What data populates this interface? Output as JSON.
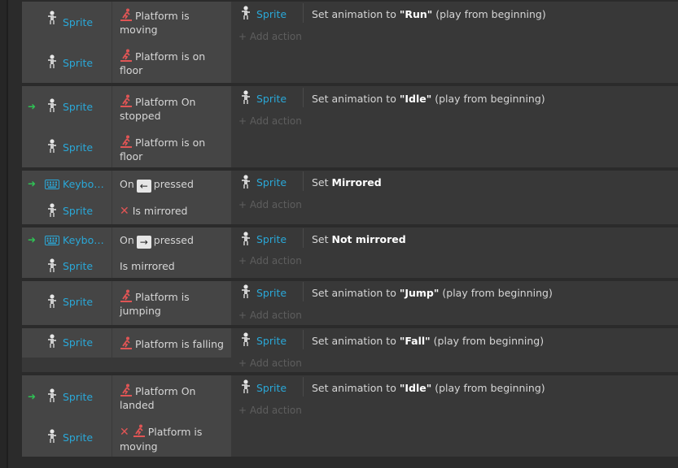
{
  "colors": {
    "object_link": "#2aa8d8",
    "trigger_arrow": "#2fc255",
    "invert_x": "#e05555",
    "add_action": "#5e5e5e"
  },
  "icons": {
    "sprite": "sprite-character-icon",
    "keyboard": "keyboard-icon",
    "platform": "platformer-behavior-icon",
    "invert": "invert-x-icon",
    "trigger": "trigger-arrow-icon",
    "add": "plus-icon"
  },
  "add_action_label": "Add action",
  "events": [
    {
      "conditions": [
        {
          "object": "Sprite",
          "text": "Platform is moving"
        },
        {
          "object": "Sprite",
          "text": "Platform is on floor"
        }
      ],
      "action": {
        "object": "Sprite",
        "prefix": "Set animation to ",
        "value": "\"Run\"",
        "suffix": " (play from beginning)"
      }
    },
    {
      "conditions": [
        {
          "object": "Sprite",
          "text": "Platform On stopped"
        },
        {
          "object": "Sprite",
          "text": "Platform is on floor"
        }
      ],
      "action": {
        "object": "Sprite",
        "prefix": "Set animation to ",
        "value": "\"Idle\"",
        "suffix": " (play from beginning)"
      }
    },
    {
      "conditions": [
        {
          "object": "Keybo…",
          "before": "On",
          "key": "←",
          "after": "pressed"
        },
        {
          "object": "Sprite",
          "text": "Is mirrored"
        }
      ],
      "action": {
        "object": "Sprite",
        "prefix": "Set ",
        "value": "Mirrored",
        "suffix": ""
      }
    },
    {
      "conditions": [
        {
          "object": "Keybo…",
          "before": "On",
          "key": "→",
          "after": "pressed"
        },
        {
          "object": "Sprite",
          "text": "Is mirrored"
        }
      ],
      "action": {
        "object": "Sprite",
        "prefix": "Set ",
        "value": "Not mirrored",
        "suffix": ""
      }
    },
    {
      "conditions": [
        {
          "object": "Sprite",
          "text": "Platform is jumping"
        }
      ],
      "action": {
        "object": "Sprite",
        "prefix": "Set animation to ",
        "value": "\"Jump\"",
        "suffix": " (play from beginning)"
      }
    },
    {
      "conditions": [
        {
          "object": "Sprite",
          "text": "Platform is falling"
        }
      ],
      "action": {
        "object": "Sprite",
        "prefix": "Set animation to ",
        "value": "\"Fall\"",
        "suffix": " (play from beginning)"
      }
    },
    {
      "conditions": [
        {
          "object": "Sprite",
          "text": "Platform On landed"
        },
        {
          "object": "Sprite",
          "text": "Platform is moving"
        }
      ],
      "action": {
        "object": "Sprite",
        "prefix": "Set animation to ",
        "value": "\"Idle\"",
        "suffix": " (play from beginning)"
      }
    }
  ]
}
